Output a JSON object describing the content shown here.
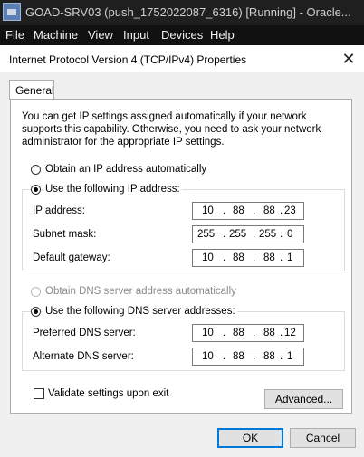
{
  "host": {
    "title": "GOAD-SRV03 (push_1752022087_6316) [Running] - Oracle...",
    "icon": "virtualbox-icon",
    "menu": [
      "File",
      "Machine",
      "View",
      "Input",
      "Devices",
      "Help"
    ]
  },
  "dialog": {
    "title": "Internet Protocol Version 4 (TCP/IPv4) Properties",
    "close_glyph": "✕",
    "tab": "General",
    "intro": "You can get IP settings assigned automatically if your network supports this capability. Otherwise, you need to ask your network administrator for the appropriate IP settings.",
    "ip_auto": {
      "label": "Obtain an IP address automatically",
      "selected": false
    },
    "ip_manual": {
      "label": "Use the following IP address:",
      "selected": true
    },
    "ip_fields": [
      {
        "label": "IP address:",
        "octets": [
          "10",
          "88",
          "88",
          "23"
        ]
      },
      {
        "label": "Subnet mask:",
        "octets": [
          "255",
          "255",
          "255",
          "0"
        ]
      },
      {
        "label": "Default gateway:",
        "octets": [
          "10",
          "88",
          "88",
          "1"
        ]
      }
    ],
    "dns_auto": {
      "label": "Obtain DNS server address automatically",
      "selected": false,
      "enabled": false
    },
    "dns_manual": {
      "label": "Use the following DNS server addresses:",
      "selected": true
    },
    "dns_fields": [
      {
        "label": "Preferred DNS server:",
        "octets": [
          "10",
          "88",
          "88",
          "12"
        ]
      },
      {
        "label": "Alternate DNS server:",
        "octets": [
          "10",
          "88",
          "88",
          "1"
        ]
      }
    ],
    "validate": {
      "label": "Validate settings upon exit",
      "checked": false
    },
    "advanced_label": "Advanced...",
    "ok_label": "OK",
    "cancel_label": "Cancel"
  }
}
